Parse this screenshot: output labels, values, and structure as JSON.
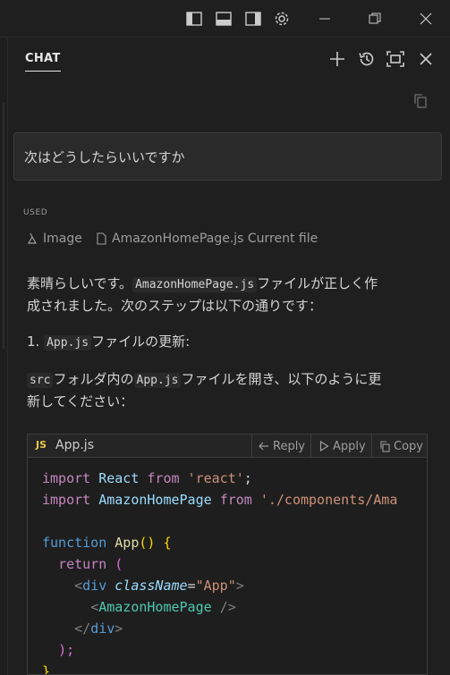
{
  "chat": {
    "tab_label": "CHAT",
    "prompt": "次はどうしたらいいですか",
    "used_label": "USED",
    "references": [
      {
        "label": "Image",
        "icon": "image-icon"
      },
      {
        "label": "AmazonHomePage.js Current file",
        "icon": "file-icon"
      }
    ]
  },
  "response": {
    "p1_a": "素晴らしいです。",
    "p1_code": "AmazonHomePage.js",
    "p1_b": "ファイルが正しく作",
    "p1_line2": "成されました。次のステップは以下の通りです：",
    "step_num": "1.",
    "step_code": "App.js",
    "step_text": "ファイルの更新:",
    "p3_code1": "src",
    "p3_a": "フォルダ内の",
    "p3_code2": "App.js",
    "p3_b": "ファイルを開き、以下のように更",
    "p3_line2": "新してください："
  },
  "codeblock": {
    "lang_badge": "JS",
    "filename": "App.js",
    "actions": {
      "reply": "Reply",
      "apply": "Apply",
      "copy": "Copy"
    },
    "lines": [
      [
        "import",
        "React",
        "from",
        "'react'",
        ";"
      ],
      [
        "import",
        "AmazonHomePage",
        "from",
        "'./components/Ama"
      ],
      [
        "function",
        "App",
        "() {"
      ],
      [
        "return",
        "("
      ],
      [
        "<",
        "div",
        "className",
        "=",
        "\"App\"",
        ">"
      ],
      [
        "<",
        "AmazonHomePage",
        "/>"
      ],
      [
        "</",
        "div",
        ">"
      ],
      [
        ");"
      ],
      [
        "}"
      ]
    ]
  },
  "colors": {
    "background": "#1f1f1f",
    "keyword": "#569cd6",
    "string": "#ce9178",
    "function": "#dcdcaa",
    "js_badge": "#e8c84e"
  }
}
